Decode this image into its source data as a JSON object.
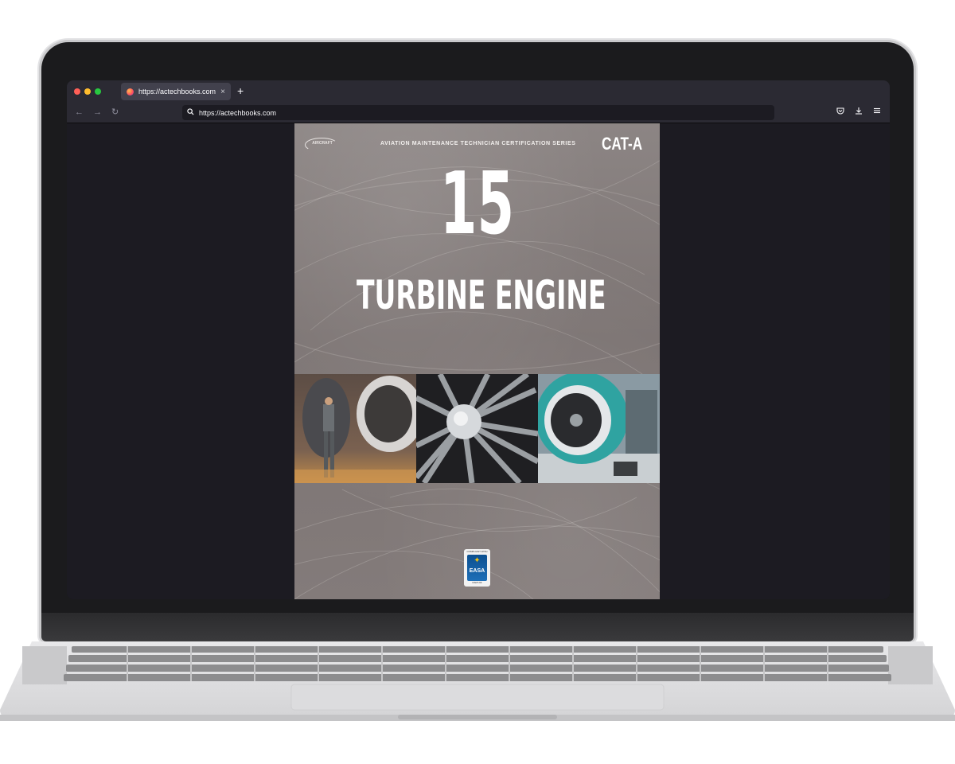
{
  "browser": {
    "tab_title": "https://actechbooks.com",
    "tab_close": "×",
    "new_tab": "+",
    "url": "https://actechbooks.com",
    "nav_back": "←",
    "nav_forward": "→",
    "nav_reload": "↻",
    "search_icon": "⌕",
    "pocket_icon": "♡",
    "download_icon": "⤓",
    "menu_icon": "≡",
    "traffic_lights": [
      "#ff5f57",
      "#febc2e",
      "#28c840"
    ]
  },
  "cover": {
    "logo_text": "AIRCRAFT",
    "series": "AVIATION MAINTENANCE TECHNICIAN CERTIFICATION SERIES",
    "category": "CAT-A",
    "number": "15",
    "title": "TURBINE ENGINE",
    "easa_top": "COMPLIANT WITH",
    "easa_label": "EASA",
    "easa_bottom": "PART-66"
  },
  "colors": {
    "browser_chrome": "#2b2a33",
    "viewport_bg": "#1c1b22",
    "cover_bg": "#847c7b",
    "easa_blue": "#0b4f8f"
  }
}
